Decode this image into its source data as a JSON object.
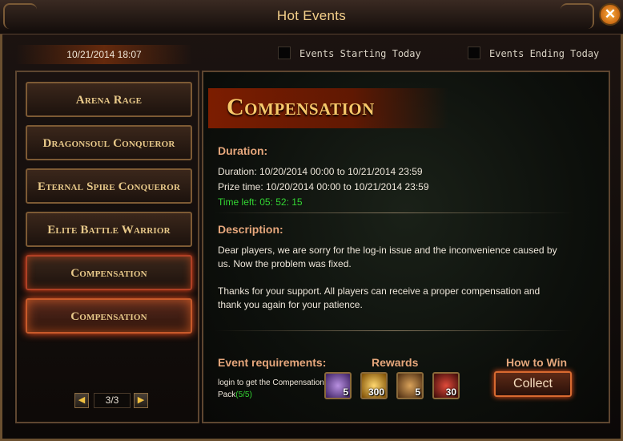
{
  "window": {
    "title": "Hot Events",
    "close_symbol": "✕"
  },
  "header": {
    "datetime": "10/21/2014 18:07",
    "filters": [
      {
        "label": "Events Starting Today",
        "checked": false
      },
      {
        "label": "Events Ending Today",
        "checked": false
      }
    ]
  },
  "sidebar": {
    "events": [
      {
        "label": "Arena Rage",
        "state": "normal"
      },
      {
        "label": "Dragonsoul Conqueror",
        "state": "normal"
      },
      {
        "label": "Eternal Spire Conqueror",
        "state": "normal"
      },
      {
        "label": "Elite Battle Warrior",
        "state": "normal"
      },
      {
        "label": "Compensation",
        "state": "highlighted"
      },
      {
        "label": "Compensation",
        "state": "selected"
      }
    ],
    "pager": {
      "text": "3/3",
      "prev_symbol": "◀",
      "next_symbol": "▶"
    }
  },
  "detail": {
    "title": "Compensation",
    "duration_heading": "Duration:",
    "duration": "Duration: 10/20/2014 00:00 to 10/21/2014 23:59",
    "prize_time": "Prize time: 10/20/2014 00:00 to 10/21/2014 23:59",
    "time_left": "Time left: 05: 52: 15",
    "description_heading": "Description:",
    "description_line1": "Dear players, we are sorry for the log-in issue and the inconvenience caused by",
    "description_line2": "us. Now the problem was fixed.",
    "description_line3": "Thanks for your support. All players can receive a proper compensation and",
    "description_line4": "thank you again for your patience.",
    "requirements_heading": "Event requirements:",
    "requirement_text": "login to get the Compensation Pack",
    "requirement_progress": "(5/5)",
    "rewards_heading": "Rewards",
    "how_to_win_heading": "How to Win",
    "rewards": [
      {
        "icon": "scroll-icon",
        "quantity": "5",
        "color": "#6a3fa0"
      },
      {
        "icon": "gold-coin-icon",
        "quantity": "300",
        "color": "#b8860b"
      },
      {
        "icon": "treasure-chest-icon",
        "quantity": "5",
        "color": "#8b5a2b"
      },
      {
        "icon": "gift-box-icon",
        "quantity": "30",
        "color": "#a02020"
      }
    ],
    "collect_label": "Collect"
  },
  "colors": {
    "accent_gold": "#f7c86a",
    "section_heading": "#e6a77c",
    "timer_green": "#33d433",
    "selected_glow": "#ff5520"
  }
}
